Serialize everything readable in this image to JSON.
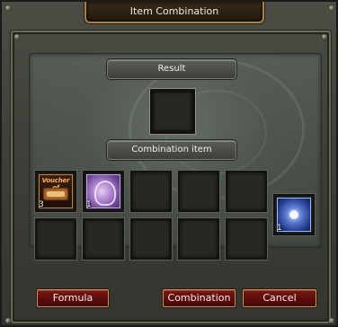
{
  "window": {
    "title": "Item Combination"
  },
  "labels": {
    "result": "Result",
    "combination_item": "Combination item"
  },
  "slots": {
    "result": {
      "empty": true
    },
    "combination": [
      {
        "index": 1,
        "item": "voucher",
        "art_text": "Voucher of",
        "qty": "3"
      },
      {
        "index": 2,
        "item": "purple-scroll",
        "qty": "1"
      },
      {
        "index": 3,
        "item": null,
        "qty": ""
      },
      {
        "index": 4,
        "item": null,
        "qty": ""
      },
      {
        "index": 5,
        "item": null,
        "qty": ""
      },
      {
        "index": 6,
        "item": null,
        "qty": ""
      },
      {
        "index": 7,
        "item": null,
        "qty": ""
      },
      {
        "index": 8,
        "item": null,
        "qty": ""
      },
      {
        "index": 9,
        "item": null,
        "qty": ""
      },
      {
        "index": 10,
        "item": null,
        "qty": ""
      }
    ],
    "material": {
      "item": "blue-gem",
      "qty": "1"
    }
  },
  "buttons": {
    "formula": "Formula",
    "combination": "Combination",
    "cancel": "Cancel"
  },
  "colors": {
    "button_red": "#5a0d0d",
    "button_border": "#c29a52",
    "title_text": "#f1e7cf"
  }
}
